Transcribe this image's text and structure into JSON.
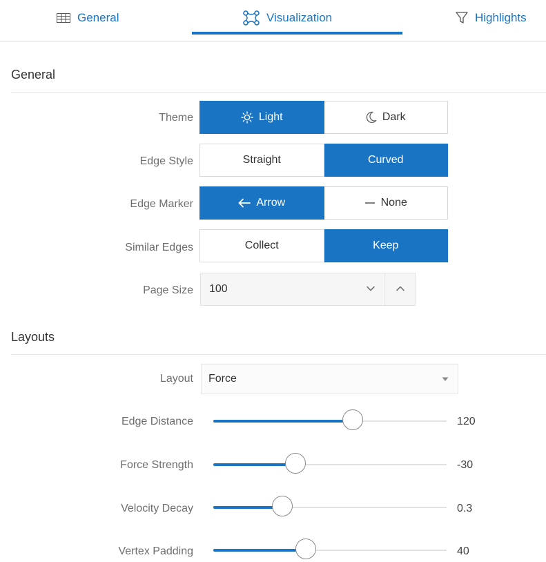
{
  "tabs": [
    {
      "label": "General",
      "icon": "table-icon"
    },
    {
      "label": "Visualization",
      "icon": "graph-nodes-icon",
      "selected": true
    },
    {
      "label": "Highlights",
      "icon": "filter-icon"
    }
  ],
  "colors": {
    "accent": "#1a74c4",
    "border": "#d8d8d8",
    "label": "#6e6e6e"
  },
  "general": {
    "title": "General",
    "theme": {
      "label": "Theme",
      "options": [
        "Light",
        "Dark"
      ],
      "selected": "Light"
    },
    "edge_style": {
      "label": "Edge Style",
      "options": [
        "Straight",
        "Curved"
      ],
      "selected": "Curved"
    },
    "edge_marker": {
      "label": "Edge Marker",
      "options": [
        "Arrow",
        "None"
      ],
      "selected": "Arrow"
    },
    "similar_edges": {
      "label": "Similar Edges",
      "options": [
        "Collect",
        "Keep"
      ],
      "selected": "Keep"
    },
    "page_size": {
      "label": "Page Size",
      "value": "100"
    }
  },
  "layouts": {
    "title": "Layouts",
    "layout": {
      "label": "Layout",
      "value": "Force"
    },
    "sliders": [
      {
        "label": "Edge Distance",
        "value": "120",
        "fraction": 0.6
      },
      {
        "label": "Force Strength",
        "value": "-30",
        "fraction": 0.355
      },
      {
        "label": "Velocity Decay",
        "value": "0.3",
        "fraction": 0.3
      },
      {
        "label": "Vertex Padding",
        "value": "40",
        "fraction": 0.4
      }
    ]
  }
}
